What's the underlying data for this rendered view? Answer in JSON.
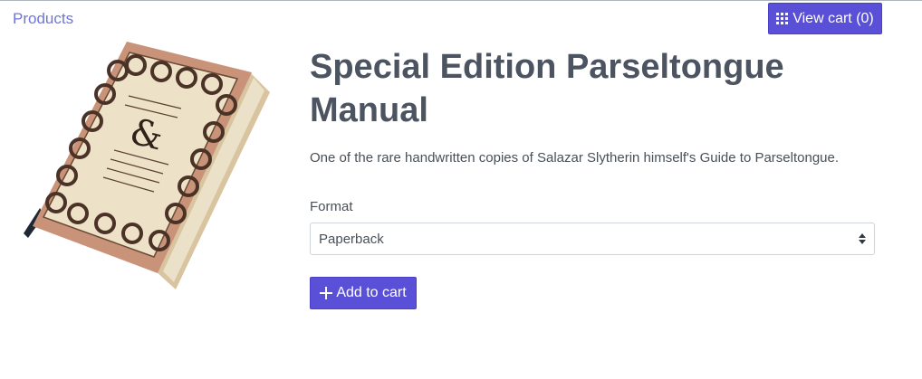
{
  "nav": {
    "products_label": "Products",
    "view_cart_label": "View cart (0)"
  },
  "product": {
    "title": "Special Edition Parseltongue Manual",
    "description": "One of the rare handwritten copies of Salazar Slytherin himself's Guide to Parseltongue.",
    "format_label": "Format",
    "format_selected": "Paperback",
    "add_to_cart_label": "Add to cart"
  },
  "colors": {
    "accent": "#5a50d8",
    "link": "#6f76d9",
    "text": "#495057"
  }
}
